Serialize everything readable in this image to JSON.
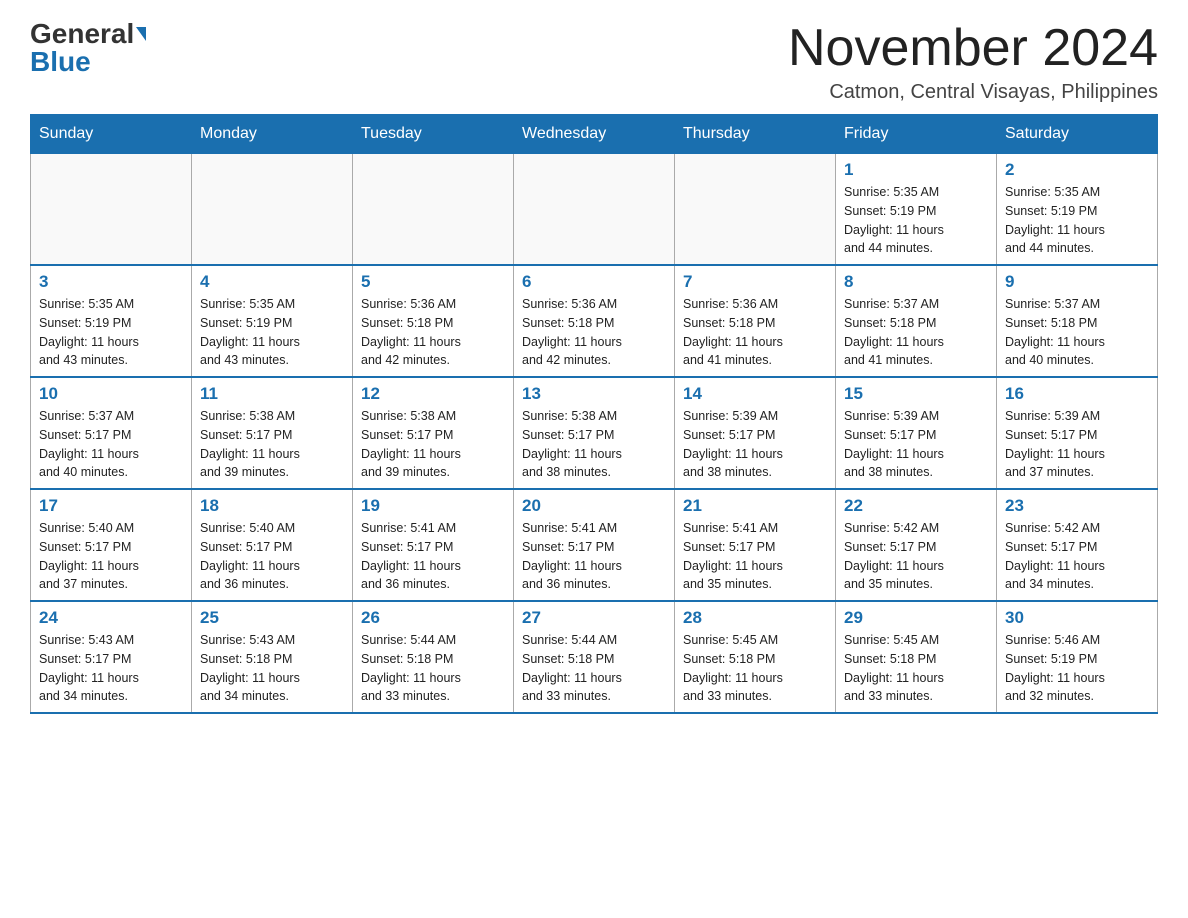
{
  "header": {
    "logo_general": "General",
    "logo_blue": "Blue",
    "month_title": "November 2024",
    "location": "Catmon, Central Visayas, Philippines"
  },
  "days_of_week": [
    "Sunday",
    "Monday",
    "Tuesday",
    "Wednesday",
    "Thursday",
    "Friday",
    "Saturday"
  ],
  "weeks": [
    [
      {
        "day": "",
        "info": ""
      },
      {
        "day": "",
        "info": ""
      },
      {
        "day": "",
        "info": ""
      },
      {
        "day": "",
        "info": ""
      },
      {
        "day": "",
        "info": ""
      },
      {
        "day": "1",
        "info": "Sunrise: 5:35 AM\nSunset: 5:19 PM\nDaylight: 11 hours\nand 44 minutes."
      },
      {
        "day": "2",
        "info": "Sunrise: 5:35 AM\nSunset: 5:19 PM\nDaylight: 11 hours\nand 44 minutes."
      }
    ],
    [
      {
        "day": "3",
        "info": "Sunrise: 5:35 AM\nSunset: 5:19 PM\nDaylight: 11 hours\nand 43 minutes."
      },
      {
        "day": "4",
        "info": "Sunrise: 5:35 AM\nSunset: 5:19 PM\nDaylight: 11 hours\nand 43 minutes."
      },
      {
        "day": "5",
        "info": "Sunrise: 5:36 AM\nSunset: 5:18 PM\nDaylight: 11 hours\nand 42 minutes."
      },
      {
        "day": "6",
        "info": "Sunrise: 5:36 AM\nSunset: 5:18 PM\nDaylight: 11 hours\nand 42 minutes."
      },
      {
        "day": "7",
        "info": "Sunrise: 5:36 AM\nSunset: 5:18 PM\nDaylight: 11 hours\nand 41 minutes."
      },
      {
        "day": "8",
        "info": "Sunrise: 5:37 AM\nSunset: 5:18 PM\nDaylight: 11 hours\nand 41 minutes."
      },
      {
        "day": "9",
        "info": "Sunrise: 5:37 AM\nSunset: 5:18 PM\nDaylight: 11 hours\nand 40 minutes."
      }
    ],
    [
      {
        "day": "10",
        "info": "Sunrise: 5:37 AM\nSunset: 5:17 PM\nDaylight: 11 hours\nand 40 minutes."
      },
      {
        "day": "11",
        "info": "Sunrise: 5:38 AM\nSunset: 5:17 PM\nDaylight: 11 hours\nand 39 minutes."
      },
      {
        "day": "12",
        "info": "Sunrise: 5:38 AM\nSunset: 5:17 PM\nDaylight: 11 hours\nand 39 minutes."
      },
      {
        "day": "13",
        "info": "Sunrise: 5:38 AM\nSunset: 5:17 PM\nDaylight: 11 hours\nand 38 minutes."
      },
      {
        "day": "14",
        "info": "Sunrise: 5:39 AM\nSunset: 5:17 PM\nDaylight: 11 hours\nand 38 minutes."
      },
      {
        "day": "15",
        "info": "Sunrise: 5:39 AM\nSunset: 5:17 PM\nDaylight: 11 hours\nand 38 minutes."
      },
      {
        "day": "16",
        "info": "Sunrise: 5:39 AM\nSunset: 5:17 PM\nDaylight: 11 hours\nand 37 minutes."
      }
    ],
    [
      {
        "day": "17",
        "info": "Sunrise: 5:40 AM\nSunset: 5:17 PM\nDaylight: 11 hours\nand 37 minutes."
      },
      {
        "day": "18",
        "info": "Sunrise: 5:40 AM\nSunset: 5:17 PM\nDaylight: 11 hours\nand 36 minutes."
      },
      {
        "day": "19",
        "info": "Sunrise: 5:41 AM\nSunset: 5:17 PM\nDaylight: 11 hours\nand 36 minutes."
      },
      {
        "day": "20",
        "info": "Sunrise: 5:41 AM\nSunset: 5:17 PM\nDaylight: 11 hours\nand 36 minutes."
      },
      {
        "day": "21",
        "info": "Sunrise: 5:41 AM\nSunset: 5:17 PM\nDaylight: 11 hours\nand 35 minutes."
      },
      {
        "day": "22",
        "info": "Sunrise: 5:42 AM\nSunset: 5:17 PM\nDaylight: 11 hours\nand 35 minutes."
      },
      {
        "day": "23",
        "info": "Sunrise: 5:42 AM\nSunset: 5:17 PM\nDaylight: 11 hours\nand 34 minutes."
      }
    ],
    [
      {
        "day": "24",
        "info": "Sunrise: 5:43 AM\nSunset: 5:17 PM\nDaylight: 11 hours\nand 34 minutes."
      },
      {
        "day": "25",
        "info": "Sunrise: 5:43 AM\nSunset: 5:18 PM\nDaylight: 11 hours\nand 34 minutes."
      },
      {
        "day": "26",
        "info": "Sunrise: 5:44 AM\nSunset: 5:18 PM\nDaylight: 11 hours\nand 33 minutes."
      },
      {
        "day": "27",
        "info": "Sunrise: 5:44 AM\nSunset: 5:18 PM\nDaylight: 11 hours\nand 33 minutes."
      },
      {
        "day": "28",
        "info": "Sunrise: 5:45 AM\nSunset: 5:18 PM\nDaylight: 11 hours\nand 33 minutes."
      },
      {
        "day": "29",
        "info": "Sunrise: 5:45 AM\nSunset: 5:18 PM\nDaylight: 11 hours\nand 33 minutes."
      },
      {
        "day": "30",
        "info": "Sunrise: 5:46 AM\nSunset: 5:19 PM\nDaylight: 11 hours\nand 32 minutes."
      }
    ]
  ]
}
